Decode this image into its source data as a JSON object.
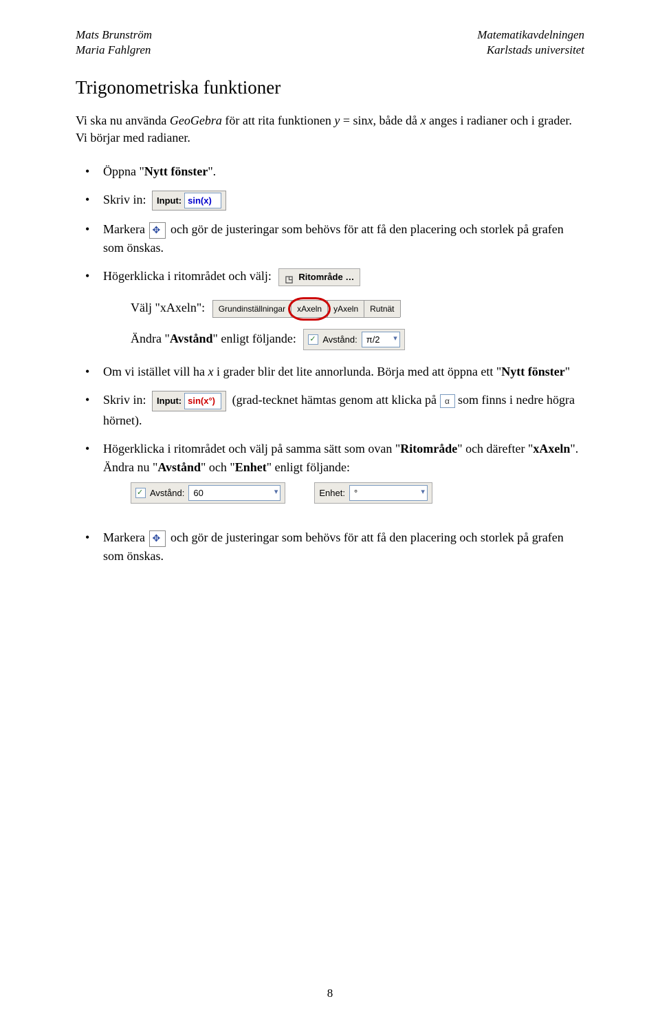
{
  "header": {
    "left1": "Mats Brunström",
    "left2": "Maria Fahlgren",
    "right1": "Matematikavdelningen",
    "right2": "Karlstads universitet"
  },
  "title": "Trigonometriska funktioner",
  "intro": {
    "lead": "Vi ska nu använda ",
    "geo": "GeoGebra",
    "mid": " för att rita funktionen ",
    "eq_y": "y",
    "eq_eq": " = sin",
    "eq_x": "x",
    "mid2": ", både då ",
    "x2": "x",
    "tail": " anges i radianer och i grader. Vi börjar med radianer."
  },
  "bullets": {
    "b1_a": "Öppna \"",
    "b1_bold": "Nytt fönster",
    "b1_c": "\".",
    "b2": "Skriv in:",
    "b3_a": "Markera ",
    "b3_b": " och gör de justeringar som behövs för att få den placering och storlek på grafen som önskas.",
    "b4": "Högerklicka i ritområdet och välj:",
    "b4_sub1": "Välj \"xAxeln\":",
    "b4_sub2_a": "Ändra \"",
    "b4_sub2_bold": "Avstånd",
    "b4_sub2_c": "\" enligt följande:",
    "b5_a": "Om vi istället vill ha ",
    "b5_x": "x",
    "b5_b": " i grader blir det lite annorlunda. Börja med att öppna ett \"",
    "b5_bold": "Nytt fönster",
    "b5_c": "\"",
    "b6_a": "Skriv in: ",
    "b6_b": " (grad-tecknet hämtas genom att klicka på ",
    "b6_c": " som finns i nedre högra hörnet).",
    "b7_a": "Högerklicka i ritområdet och välj på samma sätt som ovan \"",
    "b7_bold1": "Ritområde",
    "b7_b": "\" och därefter \"",
    "b7_bold2": "xAxeln",
    "b7_c": "\". Ändra nu \"",
    "b7_bold3": "Avstånd",
    "b7_d": "\" och \"",
    "b7_bold4": "Enhet",
    "b7_e": "\" enligt följande:",
    "b8_a": "Markera ",
    "b8_b": " och gör de justeringar som behövs för att få den placering och storlek på grafen som önskas."
  },
  "ui": {
    "input_label": "Input:",
    "sinx": "sin(x)",
    "sinxdeg": "sin(x°)",
    "ritomrade": "Ritområde …",
    "tabs": {
      "t1": "Grundinställningar",
      "t2": "xAxeln",
      "t3": "yAxeln",
      "t4": "Rutnät"
    },
    "avstand_label": "Avstånd:",
    "avstand_val_pi": "π/2",
    "avstand_val_60": "60",
    "enhet_label": "Enhet:",
    "enhet_val_deg": "°",
    "alpha": "α"
  },
  "page_number": "8"
}
